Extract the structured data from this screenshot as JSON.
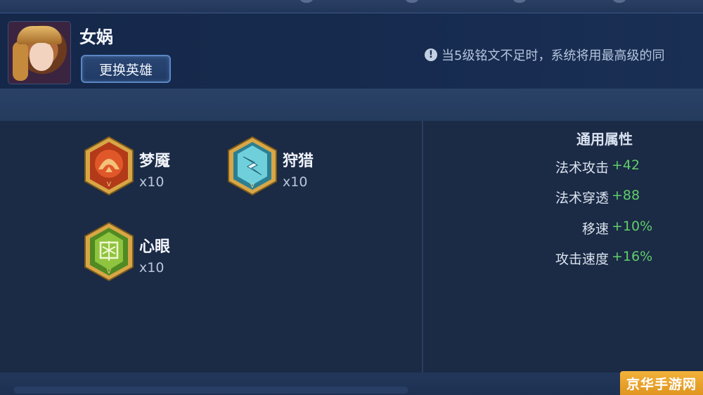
{
  "hero": {
    "name": "女娲",
    "change_button": "更换英雄"
  },
  "notice": {
    "icon": "info-icon",
    "text": "当5级铭文不足时，系统将用最高级的同"
  },
  "runes": [
    {
      "name": "梦魇",
      "count": "x10",
      "icon": "nightmare-rune-icon",
      "color": "#c2471f"
    },
    {
      "name": "狩猎",
      "count": "x10",
      "icon": "hunt-rune-icon",
      "color": "#3aa6b8"
    },
    {
      "name": "心眼",
      "count": "x10",
      "icon": "mind-eye-rune-icon",
      "color": "#6aa431"
    }
  ],
  "stats": {
    "title": "通用属性",
    "rows": [
      {
        "label": "法术攻击",
        "value": "+42"
      },
      {
        "label": "法术穿透",
        "value": "+88"
      },
      {
        "label": "移速",
        "value": "+10%"
      },
      {
        "label": "攻击速度",
        "value": "+16%"
      }
    ]
  },
  "watermark": "京华手游网",
  "colors": {
    "background": "#1b2a45",
    "positive": "#5fce6a",
    "accent_border": "#5b86c4",
    "watermark": "#f1b23a"
  }
}
